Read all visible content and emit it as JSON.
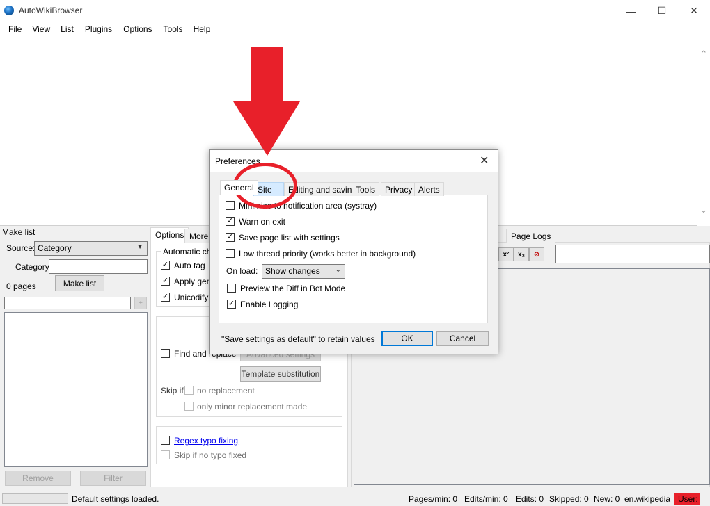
{
  "app": {
    "title": "AutoWikiBrowser"
  },
  "window_controls": {
    "minimize": "—",
    "maximize": "☐",
    "close": "✕"
  },
  "menu": [
    "File",
    "View",
    "List",
    "Plugins",
    "Options",
    "Tools",
    "Help"
  ],
  "make_list": {
    "heading": "Make list",
    "source_label": "Source:",
    "source_value": "Category",
    "category_label": "Category:",
    "category_value": "",
    "pages_count": "0 pages",
    "make_list_button": "Make list",
    "add_button": "+",
    "remove_button": "Remove",
    "filter_button": "Filter"
  },
  "options_panel": {
    "tabs": [
      "Options",
      "More..."
    ],
    "group_label": "Automatic cha",
    "auto_tag": "Auto tag",
    "apply_general": "Apply gene",
    "unicodify": "Unicodify w",
    "find_replace": "Find and replace",
    "advanced_settings": "Advanced settings",
    "template_substitution": "Template substitution",
    "skip_if": "Skip if",
    "no_replacement": "no replacement",
    "minor_replacement": "only minor replacement made",
    "regex_typo": "Regex typo fixing",
    "skip_no_typo": "Skip if no typo fixed"
  },
  "right_panel": {
    "tab_page_logs": "Page Logs",
    "superscript": "x²",
    "subscript": "x₂"
  },
  "status": {
    "message": "Default settings loaded.",
    "pages_per_min": "Pages/min: 0",
    "edits_per_min": "Edits/min: 0",
    "edits": "Edits: 0",
    "skipped": "Skipped: 0",
    "new": "New: 0",
    "site": "en.wikipedia",
    "user": "User:",
    "user_color": "#e8202a"
  },
  "preferences": {
    "title": "Preferences",
    "close": "✕",
    "tabs": [
      "General",
      "Site",
      "Editing and saving",
      "Tools",
      "Privacy",
      "Alerts"
    ],
    "minimize_systray": "Minimize to notification area (systray)",
    "warn_on_exit": "Warn on exit",
    "save_page_list": "Save page list with settings",
    "low_thread_priority": "Low thread priority (works better in background)",
    "on_load_label": "On load:",
    "on_load_value": "Show changes",
    "preview_diff": "Preview the Diff in Bot Mode",
    "enable_logging": "Enable Logging",
    "footer_note": "\"Save settings as default\" to retain values",
    "ok": "OK",
    "cancel": "Cancel",
    "checked": {
      "minimize_systray": false,
      "warn_on_exit": true,
      "save_page_list": true,
      "low_thread_priority": false,
      "preview_diff": false,
      "enable_logging": true
    }
  },
  "annotation": {
    "color": "#e8202a"
  }
}
